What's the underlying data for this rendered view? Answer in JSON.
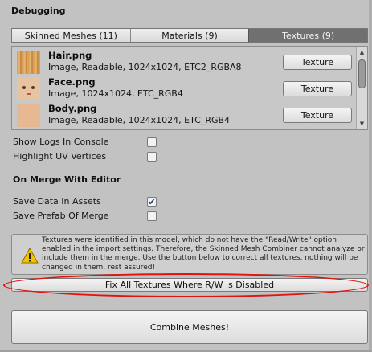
{
  "section": {
    "debugging_title": "Debugging",
    "on_merge_title": "On Merge With Editor"
  },
  "tabs": [
    {
      "label": "Skinned Meshes (11)",
      "active": false
    },
    {
      "label": "Materials (9)",
      "active": false
    },
    {
      "label": "Textures (9)",
      "active": true
    }
  ],
  "textures": [
    {
      "name": "Hair.png",
      "details": "Image, Readable, 1024x1024, ETC2_RGBA8",
      "button": "Texture"
    },
    {
      "name": "Face.png",
      "details": "Image, 1024x1024, ETC_RGB4",
      "button": "Texture"
    },
    {
      "name": "Body.png",
      "details": "Image, Readable, 1024x1024, ETC_RGB4",
      "button": "Texture"
    }
  ],
  "debug_options": [
    {
      "label": "Show Logs In Console",
      "checked": false
    },
    {
      "label": "Highlight UV Vertices",
      "checked": false
    }
  ],
  "merge_options": [
    {
      "label": "Save Data In Assets",
      "checked": true
    },
    {
      "label": "Save Prefab Of Merge",
      "checked": false
    }
  ],
  "help": {
    "icon": "warning-icon",
    "text": "Textures were identified in this model, which do not have the \"Read/Write\" option enabled in the import settings. Therefore, the Skinned Mesh Combiner cannot analyze or include them in the merge. Use the button below to correct all textures, nothing will be changed in them, rest assured!"
  },
  "buttons": {
    "fix": "Fix All Textures Where R/W is Disabled",
    "combine": "Combine Meshes!"
  },
  "colors": {
    "background": "#c2c2c2",
    "active_tab": "#707070",
    "highlight": "#e0140f",
    "warning": "#f2c200"
  }
}
